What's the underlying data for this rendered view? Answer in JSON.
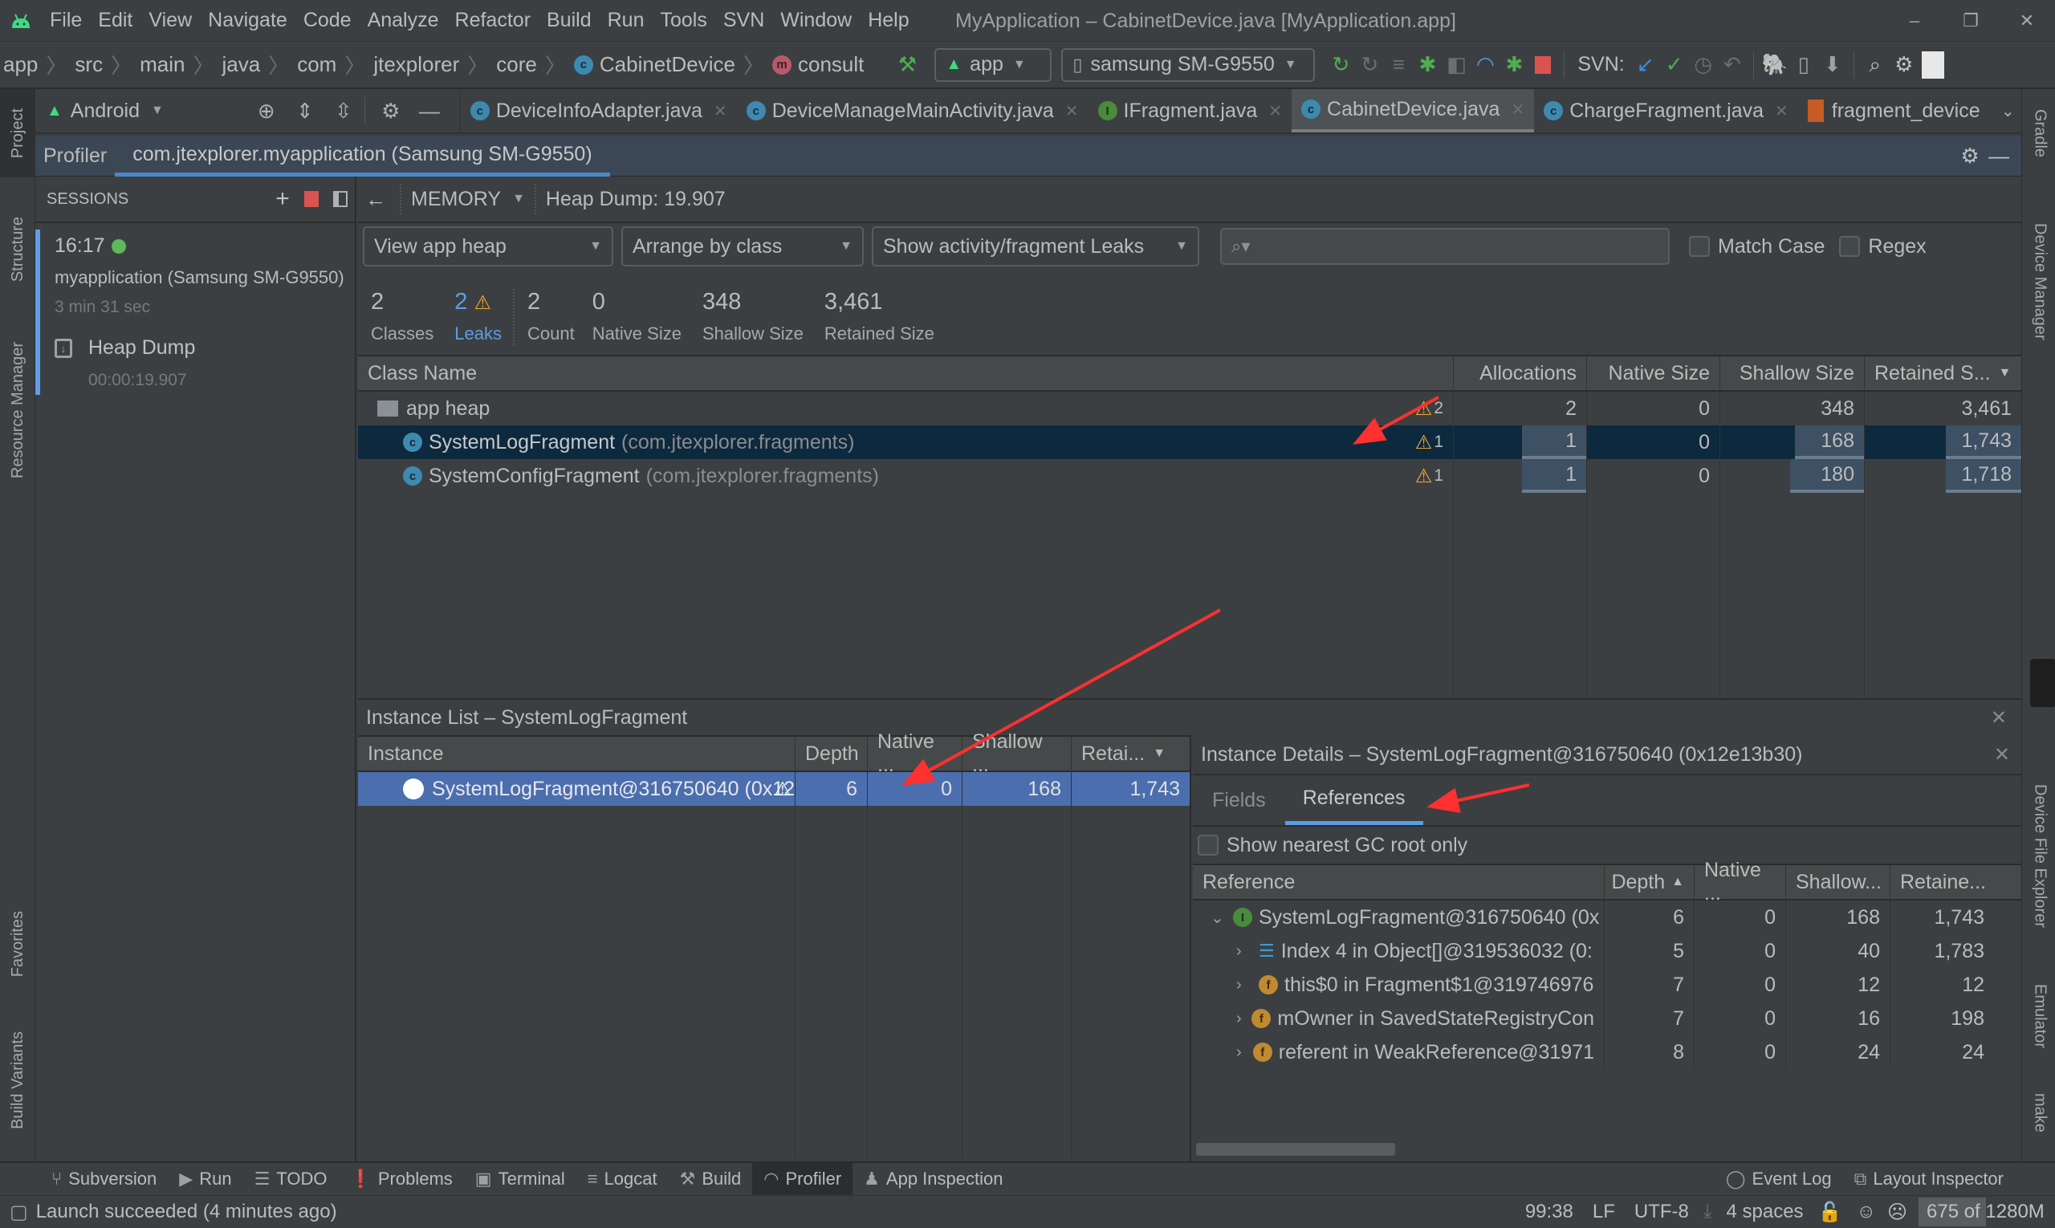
{
  "window": {
    "title": "MyApplication – CabinetDevice.java [MyApplication.app]",
    "menu": [
      "File",
      "Edit",
      "View",
      "Navigate",
      "Code",
      "Analyze",
      "Refactor",
      "Build",
      "Run",
      "Tools",
      "SVN",
      "Window",
      "Help"
    ],
    "controls": {
      "minimize": "–",
      "restore": "❐",
      "close": "✕"
    }
  },
  "breadcrumb": {
    "items": [
      "app",
      "src",
      "main",
      "java",
      "com",
      "jtexplorer",
      "core"
    ],
    "class_name": "CabinetDevice",
    "method_name": "consult"
  },
  "toolbar": {
    "run_config": "app",
    "device": "samsung SM-G9550",
    "svn_label": "SVN:"
  },
  "project_panel": {
    "view": "Android"
  },
  "editor_tabs": [
    {
      "label": "DeviceInfoAdapter.java",
      "type": "class",
      "active": false
    },
    {
      "label": "DeviceManageMainActivity.java",
      "type": "class",
      "active": false
    },
    {
      "label": "IFragment.java",
      "type": "interface",
      "active": false
    },
    {
      "label": "CabinetDevice.java",
      "type": "class",
      "active": true
    },
    {
      "label": "ChargeFragment.java",
      "type": "class",
      "active": false
    },
    {
      "label": "fragment_device",
      "type": "layout",
      "active": false
    }
  ],
  "left_stripe": [
    "Project",
    "Structure",
    "Resource Manager",
    "Favorites",
    "Build Variants"
  ],
  "right_stripe": [
    "Gradle",
    "Device Manager",
    "Device File Explorer",
    "Emulator",
    "make"
  ],
  "profiler": {
    "tab_label": "Profiler",
    "session_tab": "com.jtexplorer.myapplication (Samsung SM-G9550)",
    "sessions_label": "SESSIONS",
    "session": {
      "time": "16:17",
      "name": "myapplication (Samsung SM-G9550)",
      "duration": "3 min 31 sec",
      "artifact": "Heap Dump",
      "artifact_time": "00:00:19.907"
    },
    "memory_label": "MEMORY",
    "heap_dump_label": "Heap Dump: 19.907",
    "filters": {
      "heap": "View app heap",
      "arrange": "Arrange by class",
      "leaks": "Show activity/fragment Leaks",
      "search_placeholder": "",
      "match_case": "Match Case",
      "regex": "Regex"
    },
    "summary": [
      {
        "value": "2",
        "label": "Classes"
      },
      {
        "value": "2",
        "label": "Leaks"
      },
      {
        "value": "2",
        "label": "Count"
      },
      {
        "value": "0",
        "label": "Native Size"
      },
      {
        "value": "348",
        "label": "Shallow Size"
      },
      {
        "value": "3,461",
        "label": "Retained Size"
      }
    ],
    "class_table": {
      "columns": [
        "Class Name",
        "Allocations",
        "Native Size",
        "Shallow Size",
        "Retained S..."
      ],
      "rows": [
        {
          "name": "app heap",
          "package": "",
          "leaks": "2",
          "allocations": "2",
          "native": "0",
          "shallow": "348",
          "retained": "3,461",
          "selected": false
        },
        {
          "name": "SystemLogFragment",
          "package": "(com.jtexplorer.fragments)",
          "leaks": "1",
          "allocations": "1",
          "native": "0",
          "shallow": "168",
          "retained": "1,743",
          "selected": true
        },
        {
          "name": "SystemConfigFragment",
          "package": "(com.jtexplorer.fragments)",
          "leaks": "1",
          "allocations": "1",
          "native": "0",
          "shallow": "180",
          "retained": "1,718",
          "selected": false
        }
      ]
    },
    "instance_list": {
      "title": "Instance List – SystemLogFragment",
      "columns": [
        "Instance",
        "Depth",
        "Native ...",
        "Shallow ...",
        "Retai..."
      ],
      "rows": [
        {
          "name": "SystemLogFragment@316750640 (0x12e",
          "depth": "6",
          "native": "0",
          "shallow": "168",
          "retained": "1,743"
        }
      ]
    },
    "instance_details": {
      "title": "Instance Details – SystemLogFragment@316750640 (0x12e13b30)",
      "tabs": [
        "Fields",
        "References"
      ],
      "active_tab": "References",
      "gc_root_label": "Show nearest GC root only",
      "columns": [
        "Reference",
        "Depth",
        "Native ...",
        "Shallow...",
        "Retaine..."
      ],
      "rows": [
        {
          "icon": "instance",
          "expanded": true,
          "indent": 0,
          "name": "SystemLogFragment@316750640 (0x",
          "depth": "6",
          "native": "0",
          "shallow": "168",
          "retained": "1,743"
        },
        {
          "icon": "array",
          "expanded": false,
          "indent": 1,
          "name": "Index 4 in Object[]@319536032 (0:",
          "depth": "5",
          "native": "0",
          "shallow": "40",
          "retained": "1,783"
        },
        {
          "icon": "field",
          "expanded": false,
          "indent": 1,
          "name": "this$0 in Fragment$1@319746976",
          "depth": "7",
          "native": "0",
          "shallow": "12",
          "retained": "12"
        },
        {
          "icon": "field",
          "expanded": false,
          "indent": 1,
          "name": "mOwner in SavedStateRegistryCon",
          "depth": "7",
          "native": "0",
          "shallow": "16",
          "retained": "198"
        },
        {
          "icon": "field",
          "expanded": false,
          "indent": 1,
          "name": "referent in WeakReference@31971",
          "depth": "8",
          "native": "0",
          "shallow": "24",
          "retained": "24"
        }
      ]
    }
  },
  "bottom_tools": [
    {
      "label": "Subversion",
      "active": false
    },
    {
      "label": "Run",
      "active": false
    },
    {
      "label": "TODO",
      "active": false
    },
    {
      "label": "Problems",
      "active": false
    },
    {
      "label": "Terminal",
      "active": false
    },
    {
      "label": "Logcat",
      "active": false
    },
    {
      "label": "Build",
      "active": false
    },
    {
      "label": "Profiler",
      "active": true
    },
    {
      "label": "App Inspection",
      "active": false
    }
  ],
  "bottom_right_tools": [
    "Event Log",
    "Layout Inspector"
  ],
  "status": {
    "message": "Launch succeeded (4 minutes ago)",
    "position": "99:38",
    "line_sep": "LF",
    "encoding": "UTF-8",
    "indent": "4 spaces",
    "memory": "675 of 1280M",
    "memory_used_fraction": 0.527
  },
  "colors": {
    "accent": "#4a88c7",
    "warning": "#f0a732",
    "selection": "#0d293e",
    "instance_selection": "#4b6eaf",
    "annotation_arrow": "#ff3030"
  }
}
